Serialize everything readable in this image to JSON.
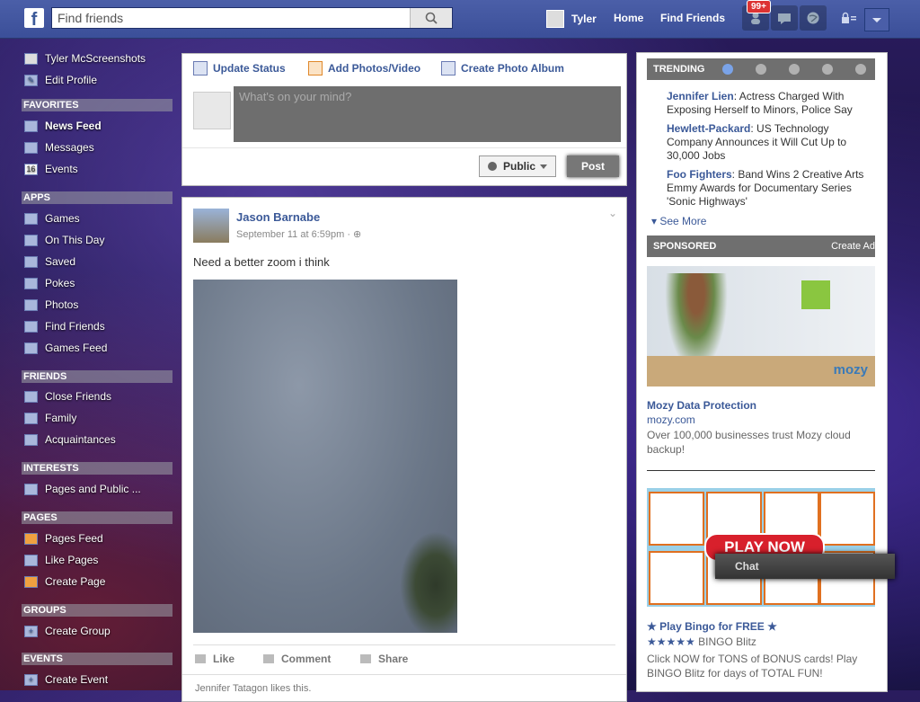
{
  "header": {
    "logo": "f",
    "search_placeholder": "Find friends",
    "user_name": "Tyler",
    "home_label": "Home",
    "find_friends_label": "Find Friends",
    "notification_count": "99+"
  },
  "sidebar": {
    "profile_name": "Tyler McScreenshots",
    "edit_profile": "Edit Profile",
    "sections": {
      "favorites": "FAVORITES",
      "apps": "APPS",
      "friends": "FRIENDS",
      "interests": "INTERESTS",
      "pages": "PAGES",
      "groups": "GROUPS",
      "events": "EVENTS"
    },
    "favorites": [
      "News Feed",
      "Messages",
      "Events"
    ],
    "events_badge": "16",
    "apps": [
      "Games",
      "On This Day",
      "Saved",
      "Pokes",
      "Photos",
      "Find Friends",
      "Games Feed"
    ],
    "friends": [
      "Close Friends",
      "Family",
      "Acquaintances"
    ],
    "interests": [
      "Pages and Public ..."
    ],
    "pages": [
      "Pages Feed",
      "Like Pages",
      "Create Page"
    ],
    "groups": [
      "Create Group"
    ],
    "events": [
      "Create Event"
    ]
  },
  "composer": {
    "tabs": [
      "Update Status",
      "Add Photos/Video",
      "Create Photo Album"
    ],
    "placeholder": "What's on your mind?",
    "audience": "Public",
    "post_label": "Post"
  },
  "story": {
    "author": "Jason Barnabe",
    "time": "September 11 at 6:59pm",
    "text": "Need a better zoom i think",
    "actions": [
      "Like",
      "Comment",
      "Share"
    ],
    "likes_text": "Jennifer Tatagon likes this."
  },
  "trending": {
    "heading": "TRENDING",
    "items": [
      {
        "name": "Jennifer Lien",
        "desc": "Actress Charged With Exposing Herself to Minors, Police Say"
      },
      {
        "name": "Hewlett-Packard",
        "desc": "US Technology Company Announces it Will Cut Up to 30,000 Jobs"
      },
      {
        "name": "Foo Fighters",
        "desc": "Band Wins 2 Creative Arts Emmy Awards for Documentary Series 'Sonic Highways'"
      }
    ],
    "see_more": "See More"
  },
  "sponsored": {
    "heading": "SPONSORED",
    "create_ad": "Create Ad",
    "ad1": {
      "title": "Mozy Data Protection",
      "url": "mozy.com",
      "body": "Over 100,000 businesses trust Mozy cloud backup!",
      "logo_text": "mozy"
    },
    "ad2": {
      "title": "Play Bingo for FREE",
      "stars": "★★★★★",
      "brand": "BINGO Blitz",
      "body": "Click NOW for TONS of BONUS cards! Play BINGO Blitz for days of TOTAL FUN!",
      "button": "PLAY NOW"
    }
  },
  "chat": {
    "label": "Chat"
  }
}
